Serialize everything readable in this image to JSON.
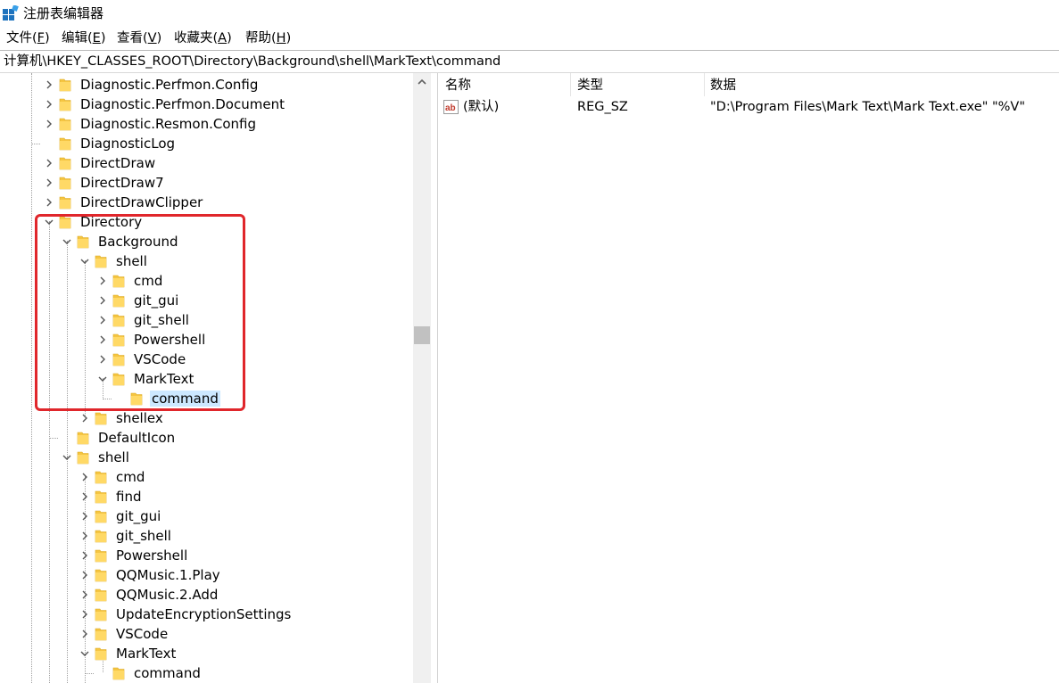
{
  "window": {
    "title": "注册表编辑器"
  },
  "menu": [
    {
      "label": "文件",
      "key": "(F)",
      "key_char": "F"
    },
    {
      "label": "编辑",
      "key": "(E)",
      "key_char": "E"
    },
    {
      "label": "查看",
      "key": "(V)",
      "key_char": "V"
    },
    {
      "label": "收藏夹",
      "key": "(A)",
      "key_char": "A"
    },
    {
      "label": "帮助",
      "key": "(H)",
      "key_char": "H"
    }
  ],
  "address": "计算机\\HKEY_CLASSES_ROOT\\Directory\\Background\\shell\\MarkText\\command",
  "tree": [
    {
      "label": "Diagnostic.Perfmon.Config",
      "depth": 0,
      "state": "collapsed"
    },
    {
      "label": "Diagnostic.Perfmon.Document",
      "depth": 0,
      "state": "collapsed"
    },
    {
      "label": "Diagnostic.Resmon.Config",
      "depth": 0,
      "state": "collapsed"
    },
    {
      "label": "DiagnosticLog",
      "depth": 0,
      "state": "leaf"
    },
    {
      "label": "DirectDraw",
      "depth": 0,
      "state": "collapsed"
    },
    {
      "label": "DirectDraw7",
      "depth": 0,
      "state": "collapsed"
    },
    {
      "label": "DirectDrawClipper",
      "depth": 0,
      "state": "collapsed"
    },
    {
      "label": "Directory",
      "depth": 0,
      "state": "expanded"
    },
    {
      "label": "Background",
      "depth": 1,
      "state": "expanded"
    },
    {
      "label": "shell",
      "depth": 2,
      "state": "expanded"
    },
    {
      "label": "cmd",
      "depth": 3,
      "state": "collapsed"
    },
    {
      "label": "git_gui",
      "depth": 3,
      "state": "collapsed"
    },
    {
      "label": "git_shell",
      "depth": 3,
      "state": "collapsed"
    },
    {
      "label": "Powershell",
      "depth": 3,
      "state": "collapsed"
    },
    {
      "label": "VSCode",
      "depth": 3,
      "state": "collapsed"
    },
    {
      "label": "MarkText",
      "depth": 3,
      "state": "expanded"
    },
    {
      "label": "command",
      "depth": 4,
      "state": "leaf",
      "selected": true
    },
    {
      "label": "shellex",
      "depth": 2,
      "state": "collapsed"
    },
    {
      "label": "DefaultIcon",
      "depth": 1,
      "state": "leaf"
    },
    {
      "label": "shell",
      "depth": 1,
      "state": "expanded"
    },
    {
      "label": "cmd",
      "depth": 2,
      "state": "collapsed"
    },
    {
      "label": "find",
      "depth": 2,
      "state": "collapsed"
    },
    {
      "label": "git_gui",
      "depth": 2,
      "state": "collapsed"
    },
    {
      "label": "git_shell",
      "depth": 2,
      "state": "collapsed"
    },
    {
      "label": "Powershell",
      "depth": 2,
      "state": "collapsed"
    },
    {
      "label": "QQMusic.1.Play",
      "depth": 2,
      "state": "collapsed"
    },
    {
      "label": "QQMusic.2.Add",
      "depth": 2,
      "state": "collapsed"
    },
    {
      "label": "UpdateEncryptionSettings",
      "depth": 2,
      "state": "collapsed"
    },
    {
      "label": "VSCode",
      "depth": 2,
      "state": "collapsed"
    },
    {
      "label": "MarkText",
      "depth": 2,
      "state": "expanded"
    },
    {
      "label": "command",
      "depth": 3,
      "state": "leaf"
    }
  ],
  "columns": {
    "name": "名称",
    "type": "类型",
    "data": "数据"
  },
  "values": [
    {
      "icon": "ab-string-icon",
      "icon_text": "ab",
      "name": "(默认)",
      "type": "REG_SZ",
      "data": "\"D:\\Program Files\\Mark Text\\Mark Text.exe\" \"%V\""
    }
  ],
  "colors": {
    "selection": "#cce8ff",
    "highlight_box": "#e0262b",
    "folder": "#f5c542"
  }
}
